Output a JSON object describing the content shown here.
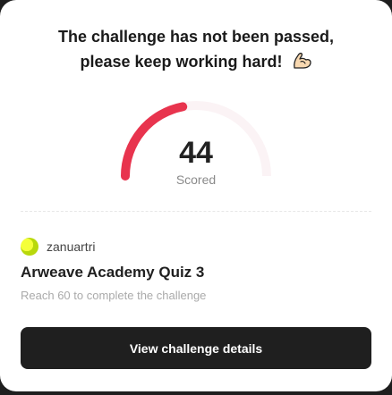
{
  "result": {
    "headline_line1": "The challenge has not been passed,",
    "headline_line2": "please keep working hard!",
    "emoji_icon": "flexed-biceps-icon"
  },
  "score": {
    "value": "44",
    "label": "Scored",
    "fraction": 0.44,
    "fill_color": "#e8344e",
    "track_color": "#fbf3f5"
  },
  "challenge": {
    "creator": "zanuartri",
    "title": "Arweave Academy Quiz 3",
    "requirement": "Reach 60 to complete the challenge"
  },
  "actions": {
    "details_label": "View challenge details"
  }
}
